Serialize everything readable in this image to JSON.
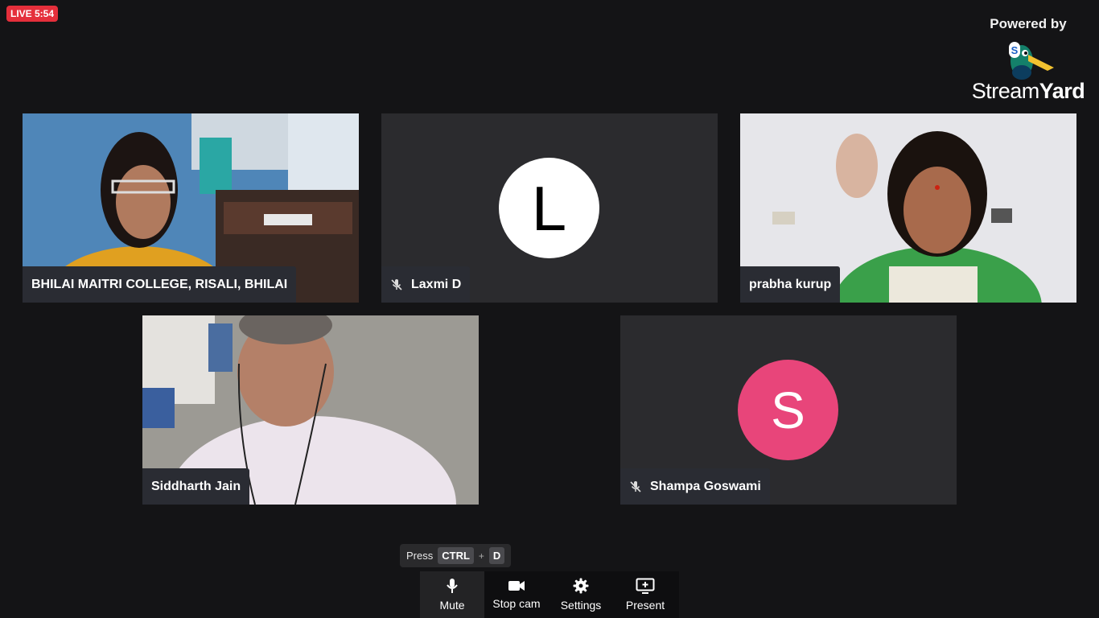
{
  "live": {
    "label": "LIVE 5:54"
  },
  "branding": {
    "powered_by": "Powered by",
    "brand_light": "Stream",
    "brand_bold": "Yard"
  },
  "participants": [
    {
      "name": "BHILAI MAITRI COLLEGE, RISALI, BHILAI",
      "type": "video",
      "muted": false
    },
    {
      "name": "Laxmi D",
      "type": "avatar",
      "initial": "L",
      "avatar_color": "#ffffff",
      "initial_color": "#000000",
      "muted": true
    },
    {
      "name": "prabha kurup",
      "type": "video",
      "muted": false
    },
    {
      "name": "Siddharth Jain",
      "type": "video",
      "muted": false
    },
    {
      "name": "Shampa Goswami",
      "type": "avatar",
      "initial": "S",
      "avatar_color": "#e8457a",
      "initial_color": "#ffffff",
      "muted": true
    }
  ],
  "shortcut_hint": {
    "press": "Press",
    "key1": "CTRL",
    "plus": "+",
    "key2": "D"
  },
  "toolbar": {
    "buttons": [
      {
        "label": "Mute",
        "icon": "microphone-icon"
      },
      {
        "label": "Stop cam",
        "icon": "camera-icon"
      },
      {
        "label": "Settings",
        "icon": "gear-icon"
      },
      {
        "label": "Present",
        "icon": "present-screen-icon"
      }
    ]
  }
}
